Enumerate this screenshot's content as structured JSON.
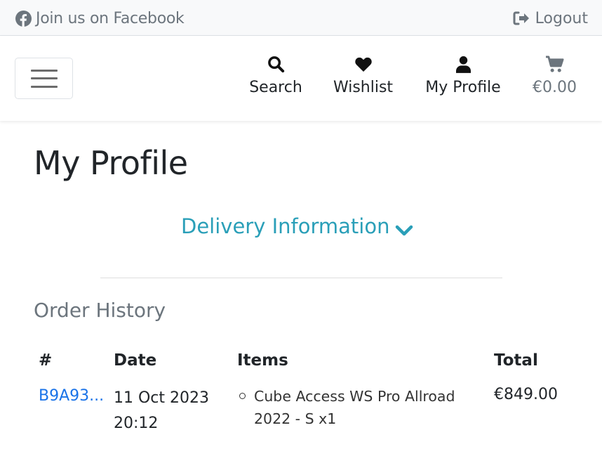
{
  "topbar": {
    "facebook_label": "Join us on Facebook",
    "facebook_icon": "facebook-icon",
    "logout_label": "Logout",
    "logout_icon": "sign-out-icon"
  },
  "navbar": {
    "search_label": "Search",
    "wishlist_label": "Wishlist",
    "profile_label": "My Profile",
    "cart_label": "€0.00"
  },
  "page": {
    "title": "My Profile",
    "delivery_toggle": "Delivery Information",
    "order_history_title": "Order History"
  },
  "orders": {
    "headers": {
      "number": "#",
      "date": "Date",
      "items": "Items",
      "total": "Total"
    },
    "rows": [
      {
        "number": "B9A93...",
        "date": "11 Oct 2023 20:12",
        "item": "Cube Access WS Pro Allroad 2022 - S x1",
        "total": "€849.00"
      }
    ]
  },
  "colors": {
    "accent": "#2a9fb8",
    "link": "#1a73e8",
    "muted": "#6c757d",
    "topbar_bg": "#f8f9fa"
  }
}
